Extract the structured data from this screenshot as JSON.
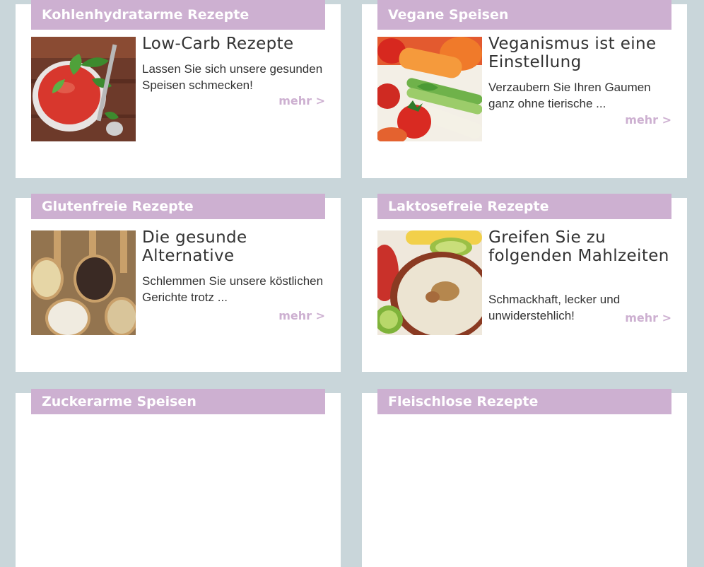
{
  "cards": [
    {
      "header": "Kohlenhydratarme Rezepte",
      "title": "Low-Carb Rezepte",
      "description": "Lassen Sie sich unsere gesunden Speisen schmecken!",
      "more": "mehr >",
      "image": "tomato-soup-with-basil"
    },
    {
      "header": "Vegane Speisen",
      "title": "Veganismus ist eine Einstellung",
      "description": "Verzaubern Sie Ihren Gaumen ganz ohne tierische ...",
      "more": "mehr >",
      "image": "fresh-vegetables"
    },
    {
      "header": "Glutenfreie Rezepte",
      "title": "Die gesunde Alternative",
      "description": "Schlemmen Sie unsere köstlichen Gerichte trotz ...",
      "more": "mehr >",
      "image": "grains-in-wooden-spoons"
    },
    {
      "header": "Laktosefreie Rezepte",
      "title": "Greifen Sie zu folgenden Mahlzeiten",
      "description": "Schmackhaft, lecker und unwiderstehlich!",
      "more": "mehr >",
      "image": "oatmeal-bowl-with-fruit"
    },
    {
      "header": "Zuckerarme Speisen"
    },
    {
      "header": "Fleischlose Rezepte"
    }
  ],
  "colors": {
    "page_background": "#c9d6da",
    "header_background": "#cdb0d1",
    "header_text": "#ffffff",
    "more_link": "#cdb0d1",
    "body_text": "#333333"
  }
}
